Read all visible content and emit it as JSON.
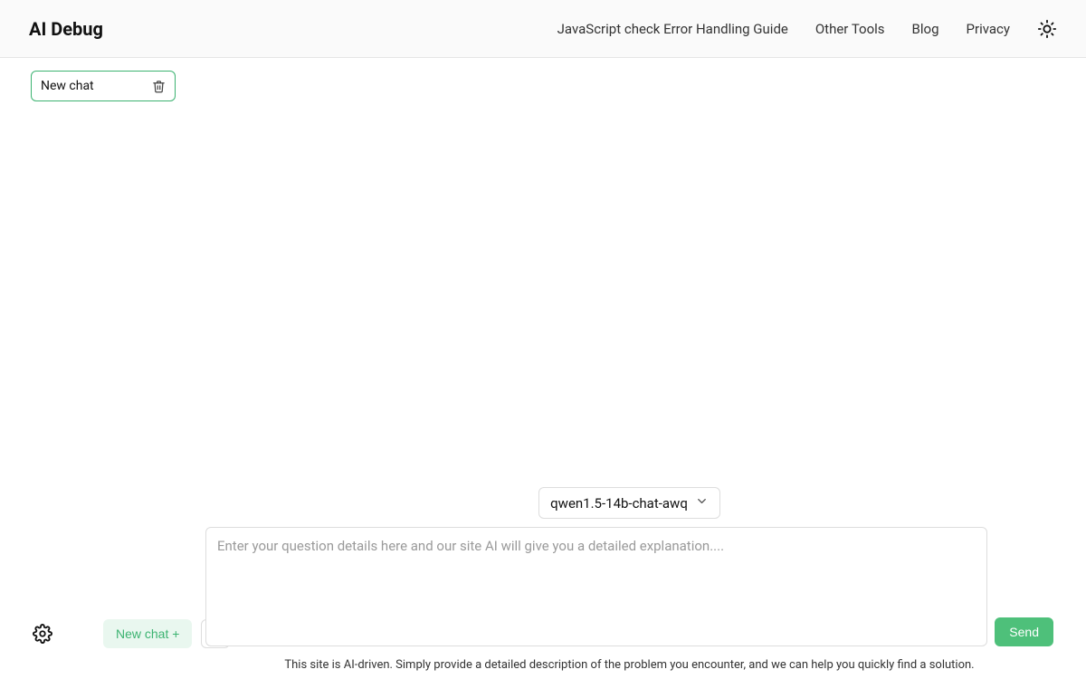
{
  "header": {
    "logo": "AI Debug",
    "nav": [
      "JavaScript check Error Handling Guide",
      "Other Tools",
      "Blog",
      "Privacy"
    ]
  },
  "sidebar": {
    "active_chat_label": "New chat"
  },
  "controls": {
    "new_chat_label": "New chat +"
  },
  "model": {
    "selected": "qwen1.5-14b-chat-awq"
  },
  "input": {
    "placeholder": "Enter your question details here and our site AI will give you a detailed explanation....",
    "send_label": "Send"
  },
  "footer": {
    "text": "This site is AI-driven. Simply provide a detailed description of the problem you encounter, and we can help you quickly find a solution."
  }
}
